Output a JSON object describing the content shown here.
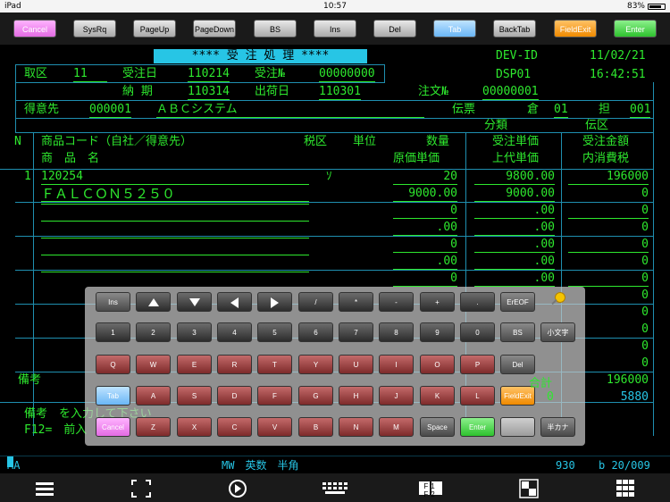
{
  "status_bar": {
    "device": "iPad",
    "time": "10:57",
    "battery": "83%"
  },
  "toolbar": {
    "keys": [
      "Cancel",
      "SysRq",
      "PageUp",
      "PageDown",
      "BS",
      "Ins",
      "Del",
      "Tab",
      "BackTab",
      "FieldExit",
      "Enter"
    ]
  },
  "screen": {
    "title": "**** 受 注 処 理 ****",
    "dev_label": "DEV-ID",
    "date": "11/02/21",
    "dsp": "DSP01",
    "clock": "16:42:51",
    "r1": {
      "torikubun_label": "取区",
      "torikubun_val": "11",
      "juchubi_label": "受注日",
      "juchubi_val": "110214",
      "juchuno_label": "受注№",
      "juchuno_val": "00000000"
    },
    "r2": {
      "noki_label": "納 期",
      "noki_val": "110314",
      "shukabi_label": "出荷日",
      "shukabi_val": "110301",
      "chumon_label": "注文№",
      "chumon_val": "00000001"
    },
    "r3": {
      "tokui_label": "得意先",
      "tokui_code": "000001",
      "tokui_name": "ＡＢＣシステム",
      "denpyo_label": "伝票",
      "kura_label": "倉",
      "kura_val": "01",
      "tan_label": "担",
      "tan_val": "001"
    },
    "r4": {
      "bunrui_label": "分類",
      "denku_label": "伝区"
    },
    "hdr": {
      "n": "N",
      "code": "商品コード（自社／得意先）",
      "zeiku": "税区",
      "tani": "単位",
      "suryo": "数量",
      "juchu_tanka": "受注単価",
      "juchu_kingaku": "受注金額",
      "shohin_mei": "商　品　名",
      "genka": "原価単価",
      "jodai": "上代単価",
      "uchi": "内消費税"
    },
    "line1": {
      "no": "1",
      "code": "120254",
      "zei": "ｿ",
      "qty": "20",
      "price": "9800.00",
      "amount": "196000",
      "name": "ＦＡＬＣＯＮ５２５０",
      "cost": "9000.00",
      "list": "9000.00",
      "tax": "0"
    },
    "blank": {
      "qty": "0",
      "cost": ".00",
      "price": ".00",
      "amount": "0"
    },
    "footer": {
      "biko_label": "備考",
      "gokei_label": "合計",
      "gokei_val": "196000",
      "tax_val": "5880",
      "zero": "0"
    },
    "msg1": "備考　を入力して下さい",
    "msg2": "F12=　前入"
  },
  "keyboard": {
    "row1": [
      "Ins",
      "up-arrow",
      "down-arrow",
      "left-arrow",
      "right-arrow",
      "/",
      "*",
      "-",
      "+",
      ".",
      "ErEOF"
    ],
    "row2": [
      "1",
      "2",
      "3",
      "4",
      "5",
      "6",
      "7",
      "8",
      "9",
      "0",
      "BS",
      "小文字"
    ],
    "row3": [
      "Q",
      "W",
      "E",
      "R",
      "T",
      "Y",
      "U",
      "I",
      "O",
      "P",
      "Del"
    ],
    "row4": [
      "Tab",
      "A",
      "S",
      "D",
      "F",
      "G",
      "H",
      "J",
      "K",
      "L",
      "FieldExit"
    ],
    "row5": [
      "Cancel",
      "Z",
      "X",
      "C",
      "V",
      "B",
      "N",
      "M",
      "Space",
      "Enter",
      "",
      "半カナ"
    ]
  },
  "status_line": {
    "ma": "MA",
    "mode": "MW　英数　半角",
    "pos": "930",
    "row": "b 20/009"
  },
  "bottom_icons": [
    "menu-icon",
    "fullscreen-icon",
    "play-icon",
    "keyboard-icon",
    "function-keys-icon",
    "input-mode-icon",
    "keypad-icon"
  ],
  "bottom_labels": {
    "fkeys": "F1 F2"
  },
  "colors": {
    "terminal_green": "#2ee82e",
    "terminal_cyan": "#27c5e5",
    "grid_line": "#1f8fb0"
  }
}
